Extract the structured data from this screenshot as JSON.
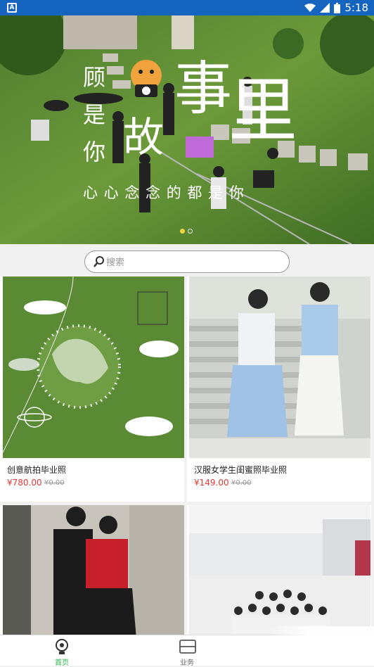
{
  "status_bar": {
    "time": "5:18",
    "left_icon_letter": "A"
  },
  "banner": {
    "col_text": [
      "顾",
      "是",
      "你"
    ],
    "big_text": [
      "事",
      "里",
      "故"
    ],
    "subtitle": "心 心 念 念 的 都 是 你",
    "slide_count": 2,
    "active_slide": 0
  },
  "search": {
    "placeholder": "搜索",
    "value": ""
  },
  "products": [
    {
      "title": "创意航拍毕业照",
      "price": "¥780.00",
      "old_price": "¥0.00"
    },
    {
      "title": "汉服女学生闺蜜照毕业照",
      "price": "¥149.00",
      "old_price": "¥0.00"
    },
    {
      "title": "",
      "price": "",
      "old_price": ""
    },
    {
      "title": "",
      "price": "",
      "old_price": ""
    }
  ],
  "tabbar": {
    "home_label": "首页",
    "business_label": "业务"
  },
  "colors": {
    "status_bar": "#1565c0",
    "accent_green": "#27b34a",
    "price_red": "#e53935"
  }
}
